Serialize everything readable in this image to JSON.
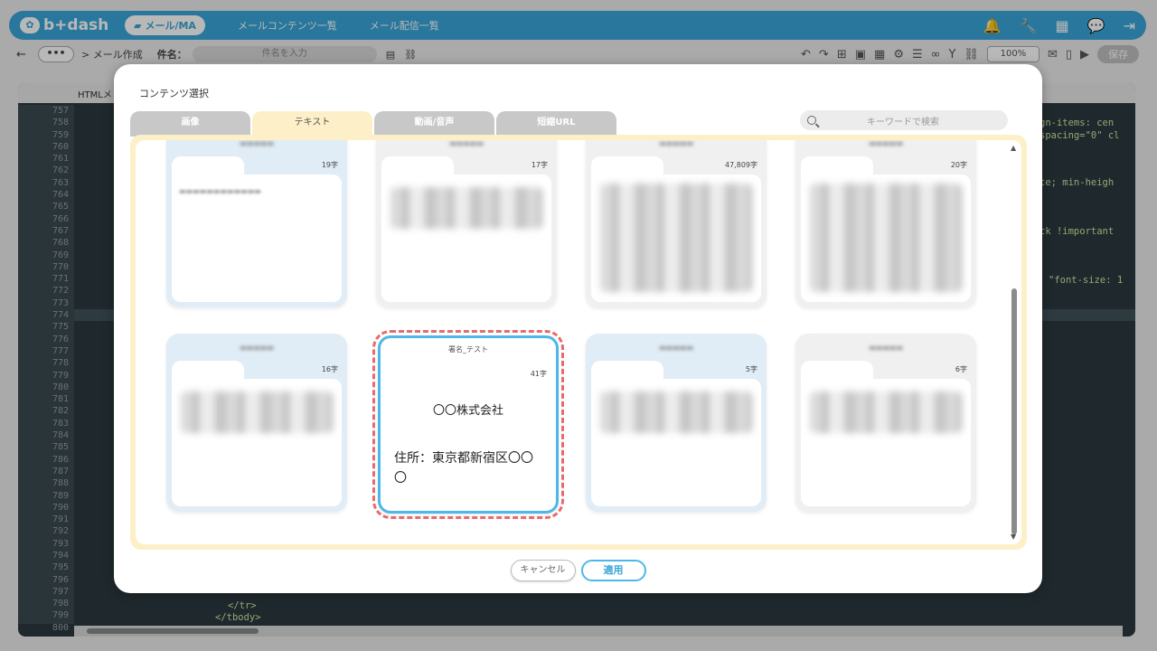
{
  "app": {
    "logo": "b+dash",
    "nav_active": "メール/MA",
    "nav_links": [
      "メールコンテンツ一覧",
      "メール配信一覧"
    ]
  },
  "toolbar": {
    "breadcrumb": "> メール作成",
    "subject_label": "件名：",
    "subject_placeholder": "件名を入力",
    "zoom": "100%",
    "save": "保存",
    "more": "•••"
  },
  "editor": {
    "tab": "HTMLメ",
    "line_numbers": [
      "757",
      "758",
      "759",
      "760",
      "761",
      "762",
      "763",
      "764",
      "765",
      "766",
      "767",
      "768",
      "769",
      "770",
      "771",
      "772",
      "773",
      "774",
      "775",
      "776",
      "777",
      "778",
      "779",
      "780",
      "781",
      "782",
      "783",
      "784",
      "785",
      "786",
      "787",
      "788",
      "789",
      "790",
      "791",
      "792",
      "793",
      "794",
      "795",
      "796",
      "797",
      "798",
      "799",
      "800"
    ],
    "code_fragments": [
      "gn-items: cen",
      "spacing=\"0\" cl",
      "te; min-heigh",
      "ck !important",
      "\"font-size: 1",
      "</tr>",
      "</tbody>"
    ]
  },
  "modal": {
    "title": "コンテンツ選択",
    "tabs": [
      "画像",
      "テキスト",
      "動画/音声",
      "短縮URL"
    ],
    "active_tab": "テキスト",
    "search_placeholder": "キーワードで検索",
    "cards": [
      {
        "count": "19字"
      },
      {
        "count": "17字"
      },
      {
        "count": "47,809字"
      },
      {
        "count": "20字"
      },
      {
        "count": "16字"
      },
      {
        "name": "署名_テスト",
        "count": "41字",
        "company": "〇〇株式会社",
        "address": "住所：東京都新宿区〇〇〇"
      },
      {
        "count": "5字"
      },
      {
        "count": "6字"
      }
    ],
    "cancel": "キャンセル",
    "apply": "適用"
  }
}
